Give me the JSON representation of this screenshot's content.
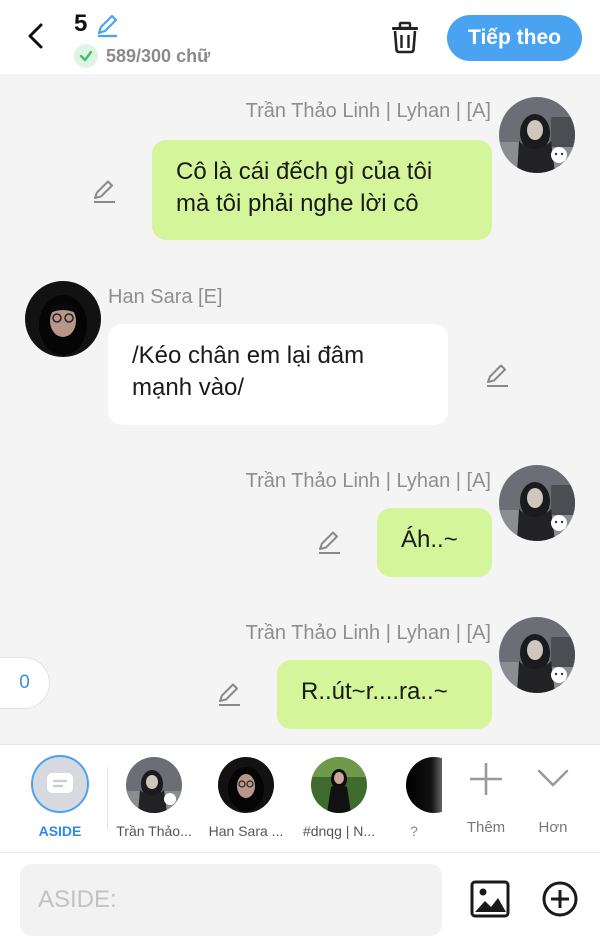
{
  "header": {
    "chapter_number": "5",
    "word_count": "589/300 chữ",
    "next_label": "Tiếp theo"
  },
  "messages": [
    {
      "sender": "Trần Thảo Linh | Lyhan | [A]",
      "text": "Cô là cái đếch gì của tôi mà tôi phải nghe lời cô",
      "side": "right"
    },
    {
      "sender": "Han Sara [E]",
      "text": "/Kéo chân em lại đâm mạnh vào/",
      "side": "left"
    },
    {
      "sender": "Trần Thảo Linh | Lyhan | [A]",
      "text": "Áh..~",
      "side": "right"
    },
    {
      "sender": "Trần Thảo Linh | Lyhan | [A]",
      "text": "R..út~r....ra..~",
      "side": "right"
    }
  ],
  "side_counter": "0",
  "characters": {
    "aside_label": "ASIDE",
    "items": [
      {
        "label": "Trần Thảo..."
      },
      {
        "label": "Han Sara ..."
      },
      {
        "label": "#dnqg | N..."
      },
      {
        "label": "? "
      }
    ],
    "add_label": "Thêm",
    "more_label": "Hơn"
  },
  "input": {
    "placeholder": "ASIDE:"
  },
  "colors": {
    "accent": "#4aa3f0",
    "bubble_green": "#d4f59a",
    "check_green": "#3cc463"
  }
}
